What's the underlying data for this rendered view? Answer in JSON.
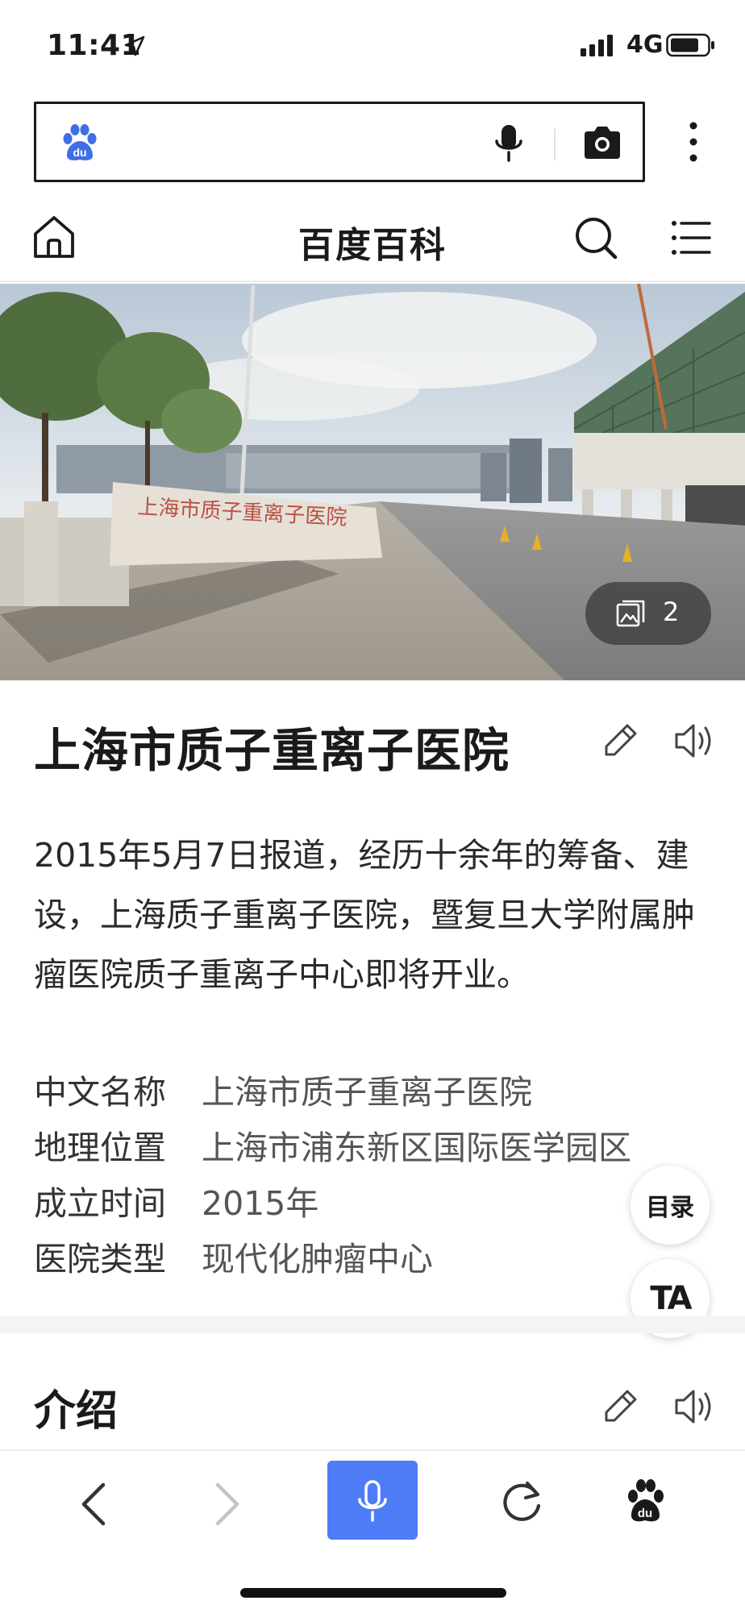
{
  "status_bar": {
    "time": "11:41",
    "network": "4G",
    "icons": [
      "location-arrow-icon",
      "signal-icon",
      "battery-icon"
    ]
  },
  "search": {
    "logo_text": "du",
    "icons": [
      "baidu-paw-icon",
      "mic-icon",
      "camera-icon",
      "more-icon"
    ]
  },
  "header": {
    "title": "百度百科",
    "icons": [
      "home-icon",
      "search-icon",
      "menu-icon"
    ]
  },
  "hero": {
    "photo_count": "2",
    "icons": [
      "gallery-icon"
    ]
  },
  "entry": {
    "title": "上海市质子重离子医院",
    "summary": "2015年5月7日报道，经历十余年的筹备、建设，上海质子重离子医院，暨复旦大学附属肿瘤医院质子重离子中心即将开业。",
    "icons": [
      "edit-icon",
      "speaker-icon"
    ]
  },
  "info": [
    {
      "key": "中文名称",
      "value": "上海市质子重离子医院"
    },
    {
      "key": "地理位置",
      "value": "上海市浦东新区国际医学园区"
    },
    {
      "key": "成立时间",
      "value": "2015年"
    },
    {
      "key": "医院类型",
      "value": "现代化肿瘤中心"
    }
  ],
  "floating": {
    "toc_label": "目录",
    "ta_label": "TA"
  },
  "section": {
    "title": "介绍"
  },
  "bottom_bar": {
    "icons": [
      "back-icon",
      "forward-icon",
      "voice-mic-icon",
      "refresh-icon",
      "baidu-paw-icon"
    ]
  },
  "colors": {
    "accent": "#4e7cf6",
    "text": "#1a1a1a",
    "muted": "#555555",
    "disabled": "#c4c4c4"
  }
}
